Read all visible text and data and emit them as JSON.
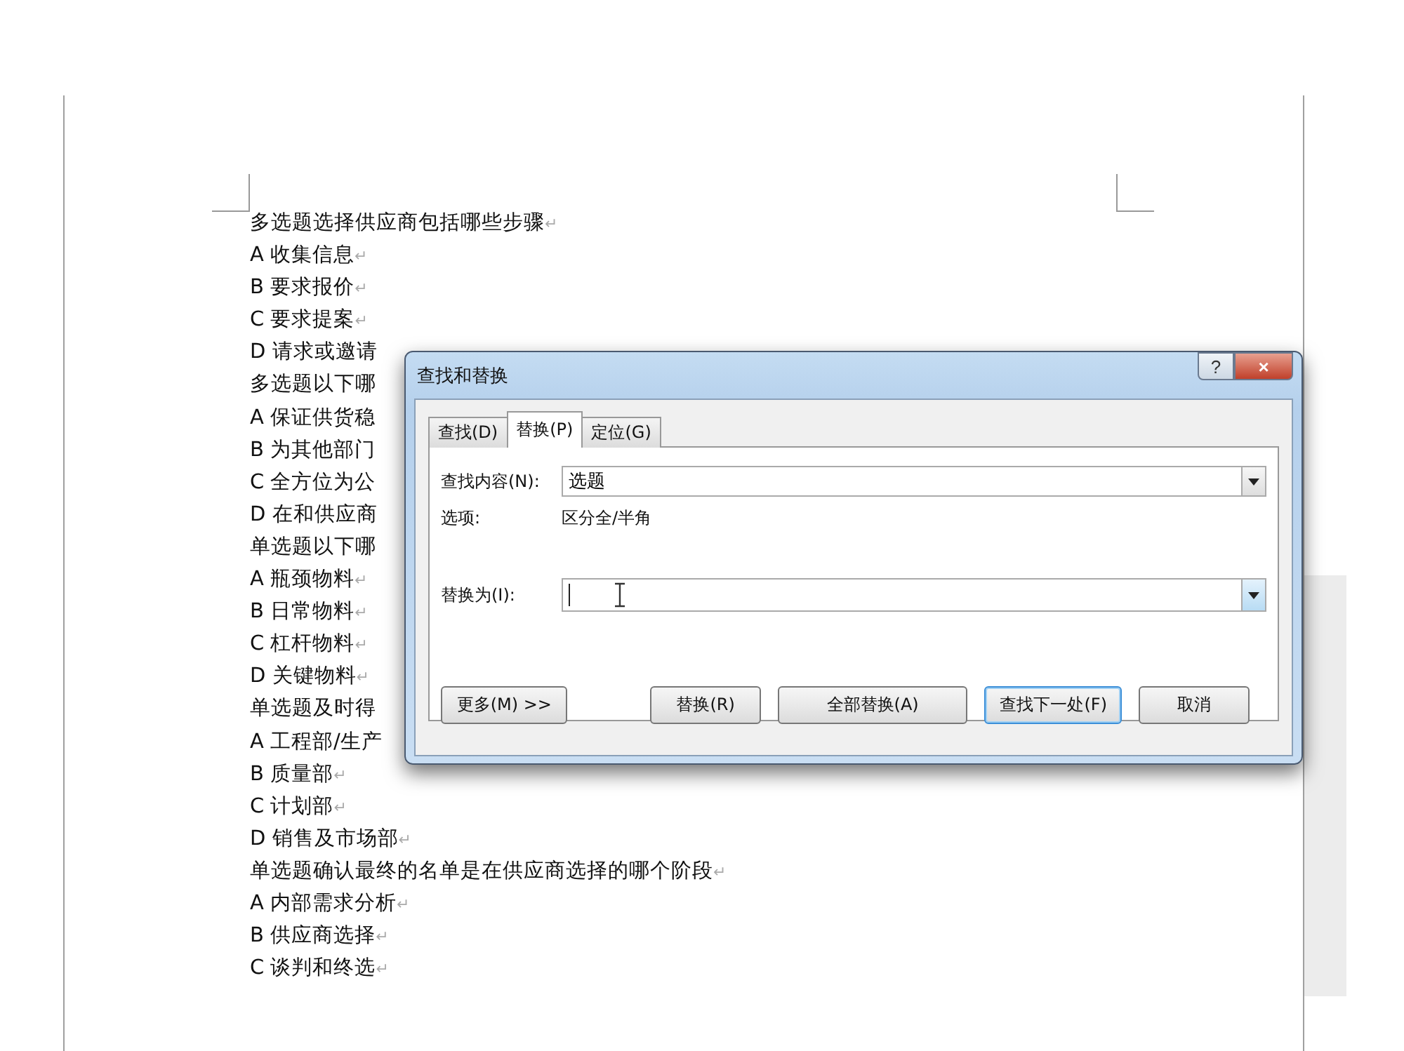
{
  "document": {
    "lines": [
      {
        "text": "多选题选择供应商包括哪些步骤",
        "end_mark": "↵"
      },
      {
        "text": "A 收集信息",
        "end_mark": "↵"
      },
      {
        "text": "B 要求报价",
        "end_mark": "↵"
      },
      {
        "text": "C 要求提案",
        "end_mark": "↵"
      },
      {
        "text": "D 请求或邀请"
      },
      {
        "text": "多选题以下哪"
      },
      {
        "text": "A 保证供货稳"
      },
      {
        "text": "B 为其他部门"
      },
      {
        "text": "C 全方位为公"
      },
      {
        "text": "D 在和供应商"
      },
      {
        "text": "单选题以下哪"
      },
      {
        "text": "A 瓶颈物料",
        "end_mark": "↵"
      },
      {
        "text": "B 日常物料",
        "end_mark": "↵"
      },
      {
        "text": "C 杠杆物料",
        "end_mark": "↵"
      },
      {
        "text": "D 关键物料",
        "end_mark": "↵"
      },
      {
        "text": "单选题及时得"
      },
      {
        "text": "A 工程部/生产"
      },
      {
        "text": "B 质量部",
        "end_mark": "↵"
      },
      {
        "text": "C 计划部",
        "end_mark": "↵"
      },
      {
        "text": "D 销售及市场部",
        "end_mark": "↵"
      },
      {
        "text": "单选题确认最终的名单是在供应商选择的哪个阶段",
        "end_mark": "↵"
      },
      {
        "text": "A 内部需求分析",
        "end_mark": "↵"
      },
      {
        "text": "B 供应商选择",
        "end_mark": "↵"
      },
      {
        "text": "C 谈判和终选",
        "end_mark": "↵"
      }
    ]
  },
  "dialog": {
    "title": "查找和替换",
    "help": "?",
    "close": "×",
    "tabs": [
      {
        "label": "查找(D)",
        "selected": false
      },
      {
        "label": "替换(P)",
        "selected": true
      },
      {
        "label": "定位(G)",
        "selected": false
      }
    ],
    "find": {
      "label": "查找内容(N):",
      "value": "选题"
    },
    "options": {
      "label": "选项:",
      "value": "区分全/半角"
    },
    "replace": {
      "label": "替换为(I):"
    },
    "buttons": [
      {
        "label": "更多(M) >>",
        "default": false
      },
      {
        "label": "替换(R)",
        "default": false
      },
      {
        "label": "全部替换(A)",
        "default": false
      },
      {
        "label": "查找下一处(F)",
        "default": true
      },
      {
        "label": "取消",
        "default": false
      }
    ]
  }
}
